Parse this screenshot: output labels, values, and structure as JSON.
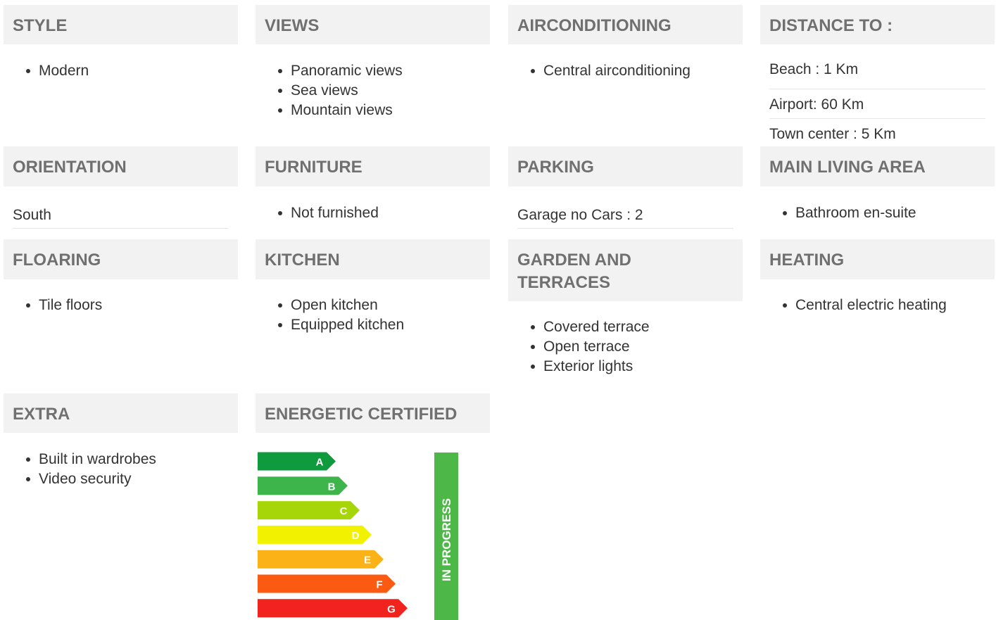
{
  "style": {
    "title": "STYLE",
    "items": [
      "Modern"
    ]
  },
  "views": {
    "title": "VIEWS",
    "items": [
      "Panoramic views",
      "Sea views",
      "Mountain views"
    ]
  },
  "aircon": {
    "title": "AIRCONDITIONING",
    "items": [
      "Central airconditioning"
    ]
  },
  "distance": {
    "title": "DISTANCE TO :",
    "rows": [
      "Beach : 1 Km",
      "Airport: 60 Km",
      "Town center : 5 Km"
    ]
  },
  "orientation": {
    "title": "ORIENTATION",
    "value": "South"
  },
  "furniture": {
    "title": "FURNITURE",
    "items": [
      "Not furnished"
    ]
  },
  "parking": {
    "title": "PARKING",
    "value": "Garage no Cars : 2"
  },
  "living": {
    "title": "MAIN LIVING AREA",
    "items": [
      "Bathroom en-suite"
    ]
  },
  "flooring": {
    "title": "FLOARING",
    "items": [
      "Tile floors"
    ]
  },
  "kitchen": {
    "title": "KITCHEN",
    "items": [
      "Open kitchen",
      "Equipped kitchen"
    ]
  },
  "garden": {
    "title_line1": "GARDEN AND",
    "title_line2": "TERRACES",
    "items": [
      "Covered terrace",
      "Open terrace",
      "Exterior lights"
    ]
  },
  "heating": {
    "title": "HEATING",
    "items": [
      "Central electric heating"
    ]
  },
  "extra": {
    "title": "EXTRA",
    "items": [
      "Built in wardrobes",
      "Video security"
    ]
  },
  "energy": {
    "title": "ENERGETIC CERTIFIED",
    "status": "IN PROGRESS",
    "status_color": "#4db848",
    "ratings": [
      {
        "label": "A",
        "color": "#0f9a3e"
      },
      {
        "label": "B",
        "color": "#3db54a"
      },
      {
        "label": "C",
        "color": "#a6d608"
      },
      {
        "label": "D",
        "color": "#f2f200"
      },
      {
        "label": "E",
        "color": "#fbb216"
      },
      {
        "label": "F",
        "color": "#fb5a12"
      },
      {
        "label": "G",
        "color": "#f0231f"
      }
    ]
  }
}
